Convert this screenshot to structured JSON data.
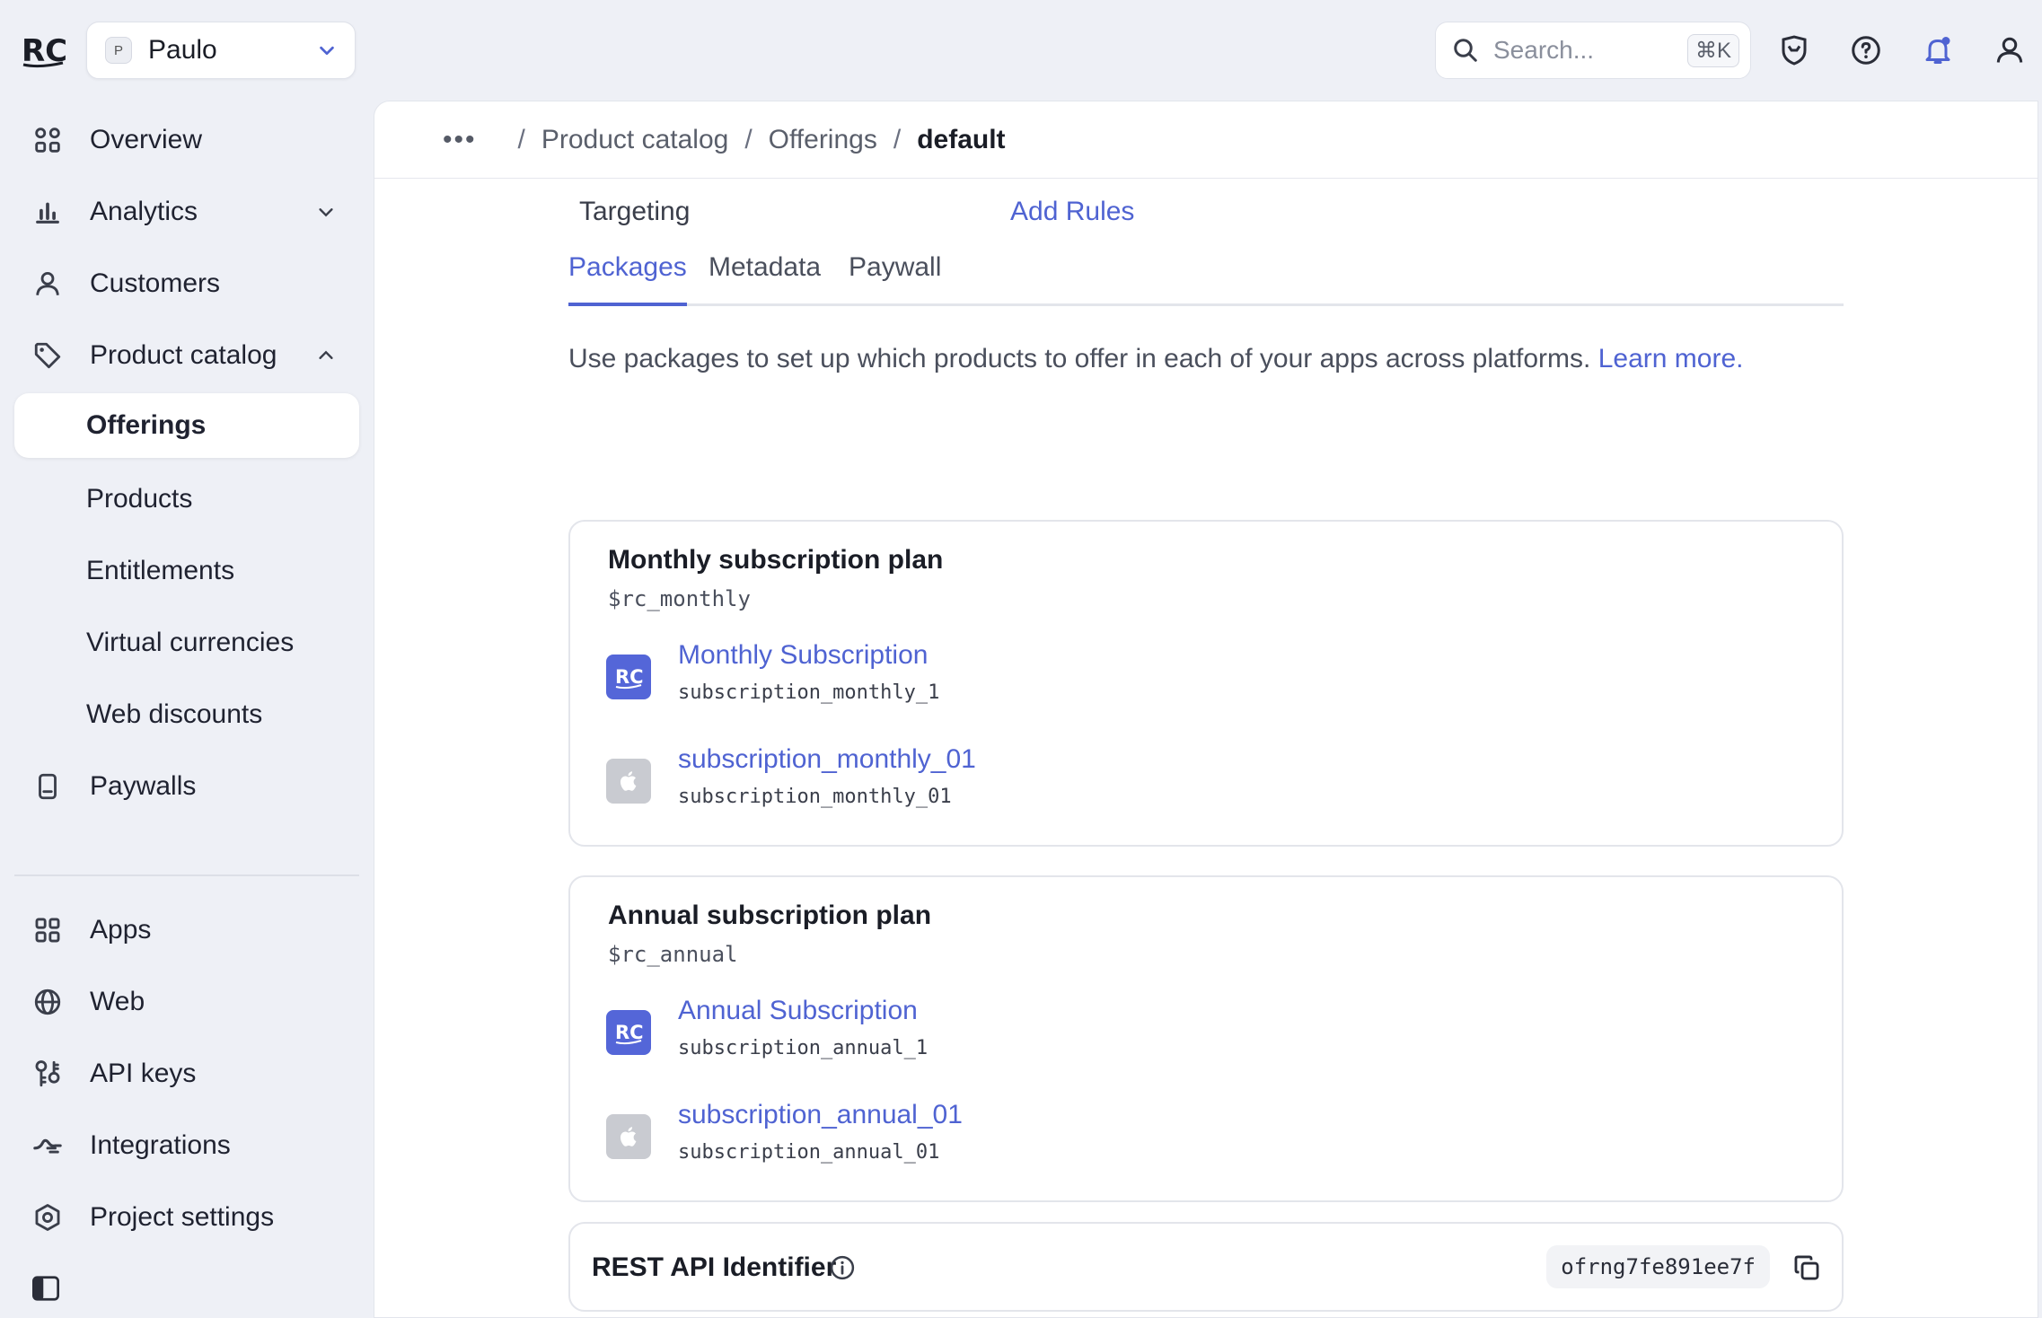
{
  "header": {
    "logo_text": "RC",
    "project": {
      "avatar_letter": "P",
      "name": "Paulo"
    },
    "search": {
      "placeholder": "Search...",
      "shortcut": "⌘K"
    },
    "icons": [
      "shield-icon",
      "help-icon",
      "notification-bell-icon",
      "user-icon"
    ]
  },
  "sidebar": {
    "items": [
      {
        "label": "Overview",
        "icon": "grid-icon"
      },
      {
        "label": "Analytics",
        "icon": "bar-chart-icon"
      },
      {
        "label": "Customers",
        "icon": "person-icon"
      },
      {
        "label": "Product catalog",
        "icon": "tag-icon"
      },
      {
        "label": "Offerings"
      },
      {
        "label": "Products"
      },
      {
        "label": "Entitlements"
      },
      {
        "label": "Virtual currencies"
      },
      {
        "label": "Web discounts"
      },
      {
        "label": "Paywalls",
        "icon": "device-icon"
      }
    ],
    "bottom_items": [
      {
        "label": "Apps",
        "icon": "apps-icon"
      },
      {
        "label": "Web",
        "icon": "globe-icon"
      },
      {
        "label": "API keys",
        "icon": "key-icon"
      },
      {
        "label": "Integrations",
        "icon": "integrations-icon"
      },
      {
        "label": "Project settings",
        "icon": "settings-icon"
      }
    ]
  },
  "breadcrumb": {
    "more": "•••",
    "items": [
      "Product catalog",
      "Offerings",
      "default"
    ]
  },
  "targeting": {
    "label": "Targeting",
    "action": "Add Rules"
  },
  "tabs": [
    "Packages",
    "Metadata",
    "Paywall"
  ],
  "description": {
    "text": "Use packages to set up which products to offer in each of your apps across platforms.",
    "link": "Learn more."
  },
  "packages": [
    {
      "title": "Monthly subscription plan",
      "identifier": "$rc_monthly",
      "products": [
        {
          "name": "Monthly Subscription",
          "id": "subscription_monthly_1",
          "store": "rc"
        },
        {
          "name": "subscription_monthly_01",
          "id": "subscription_monthly_01",
          "store": "apple"
        }
      ]
    },
    {
      "title": "Annual subscription plan",
      "identifier": "$rc_annual",
      "products": [
        {
          "name": "Annual Subscription",
          "id": "subscription_annual_1",
          "store": "rc"
        },
        {
          "name": "subscription_annual_01",
          "id": "subscription_annual_01",
          "store": "apple"
        }
      ]
    }
  ],
  "rest_api": {
    "label": "REST API Identifier",
    "value": "ofrng7fe891ee7f"
  },
  "colors": {
    "accent": "#4f63d2",
    "background": "#eef0f6",
    "rc_badge": "#5466d8"
  }
}
